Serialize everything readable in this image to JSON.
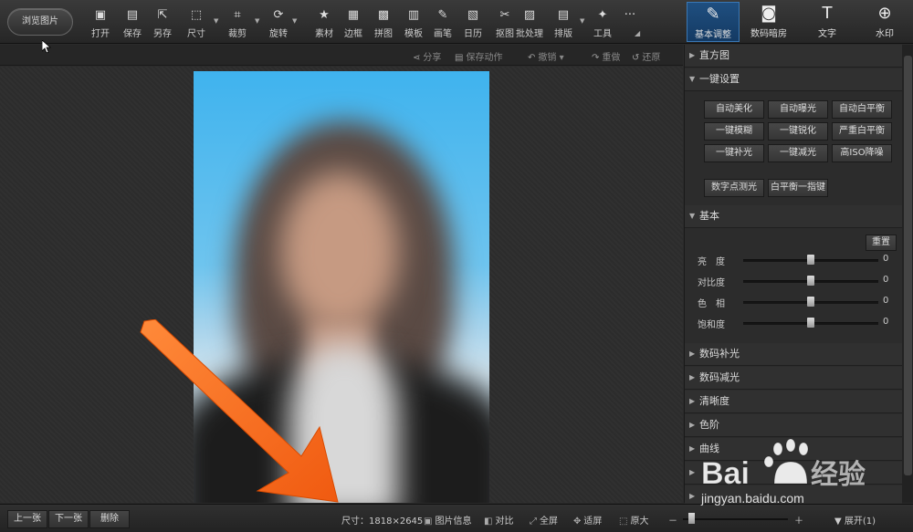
{
  "toolbar": {
    "browse_label": "浏览图片",
    "tools": [
      {
        "label": "打开",
        "icon": "open-image-icon",
        "glyph": "▣"
      },
      {
        "label": "保存",
        "icon": "save-icon",
        "glyph": "▤"
      },
      {
        "label": "另存",
        "icon": "save-as-icon",
        "glyph": "⇱"
      },
      {
        "label": "尺寸",
        "icon": "resize-icon",
        "glyph": "⬚"
      },
      {
        "label": "裁剪",
        "icon": "crop-icon",
        "glyph": "⌗"
      },
      {
        "label": "旋转",
        "icon": "rotate-icon",
        "glyph": "⟳"
      },
      {
        "label": "素材",
        "icon": "material-icon",
        "glyph": "★"
      },
      {
        "label": "边框",
        "icon": "border-icon",
        "glyph": "▦"
      },
      {
        "label": "拼图",
        "icon": "collage-icon",
        "glyph": "▩"
      },
      {
        "label": "模板",
        "icon": "template-icon",
        "glyph": "▥"
      },
      {
        "label": "画笔",
        "icon": "brush-icon",
        "glyph": "✎"
      },
      {
        "label": "日历",
        "icon": "calendar-icon",
        "glyph": "▧"
      },
      {
        "label": "抠图",
        "icon": "cutout-icon",
        "glyph": "✂"
      },
      {
        "label": "批处理",
        "icon": "batch-icon",
        "glyph": "▨"
      },
      {
        "label": "排版",
        "icon": "layout-icon",
        "glyph": "▤"
      },
      {
        "label": "工具",
        "icon": "wrench-icon",
        "glyph": "✦"
      },
      {
        "label": "",
        "icon": "more-icon",
        "glyph": "···"
      }
    ]
  },
  "modes": [
    {
      "label": "基本调整",
      "icon": "basic-adjust-icon",
      "glyph": "✎",
      "active": true
    },
    {
      "label": "数码暗房",
      "icon": "darkroom-icon",
      "glyph": "◙",
      "active": false
    },
    {
      "label": "文字",
      "icon": "text-icon",
      "glyph": "T",
      "active": false
    },
    {
      "label": "水印",
      "icon": "watermark-icon",
      "glyph": "⊕",
      "active": false
    }
  ],
  "subbar": {
    "share": "分享",
    "save_action": "保存动作",
    "undo": "撤销",
    "redo": "重做",
    "restore": "还原"
  },
  "panel": {
    "histogram": "直方图",
    "one_click": "一键设置",
    "one_click_buttons": [
      "自动美化",
      "自动曝光",
      "自动白平衡",
      "一键模糊",
      "一键锐化",
      "严重白平衡",
      "一键补光",
      "一键减光",
      "高ISO降噪"
    ],
    "extra_buttons": [
      "数字点测光",
      "白平衡一指键"
    ],
    "basic": "基本",
    "reset": "重置",
    "sliders": [
      {
        "label": "亮　度",
        "value": "0",
        "level": 0.5
      },
      {
        "label": "对比度",
        "value": "0",
        "level": 0.5
      },
      {
        "label": "色　相",
        "value": "0",
        "level": 0.5
      },
      {
        "label": "饱和度",
        "value": "0",
        "level": 0.5
      }
    ],
    "sections": [
      "数码补光",
      "数码减光",
      "清晰度",
      "色阶",
      "曲线",
      "",
      ""
    ]
  },
  "bottombar": {
    "prev": "上一张",
    "next": "下一张",
    "delete": "删除",
    "size_label": "尺寸：1818×2645",
    "info": "图片信息",
    "compare": "对比",
    "fullscreen": "全屏",
    "fit": "适屏",
    "original": "原大",
    "minus": "－",
    "plus": "＋",
    "expand": "展开(1)",
    "zoom_level": 0.05
  },
  "watermark": {
    "text": "jingyan.baidu.com"
  }
}
